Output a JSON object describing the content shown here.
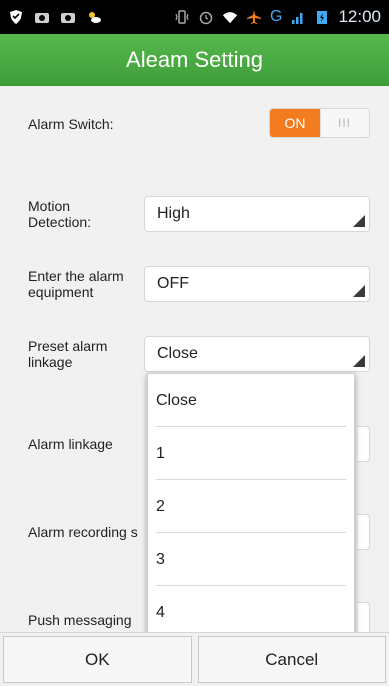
{
  "status_bar": {
    "time": "12:00",
    "network": "G",
    "left_icons": [
      "shield-icon",
      "camera-icon",
      "camera-icon",
      "weather-icon"
    ],
    "right_icons": [
      "vibrate-icon",
      "alarm-clock-icon",
      "wifi-icon",
      "airplane-icon",
      "signal-icon",
      "battery-icon"
    ]
  },
  "title": "Aleam Setting",
  "colors": {
    "title_bar": "#4caf45",
    "toggle_on": "#f47c20"
  },
  "settings": {
    "alarm_switch": {
      "label": "Alarm Switch:",
      "on_label": "ON",
      "thumb_label": "III",
      "state": "on"
    },
    "motion_detection": {
      "label": "Motion Detection:",
      "value": "High"
    },
    "enter_alarm_equipment": {
      "label": "Enter the alarm equipment",
      "value": "OFF"
    },
    "preset_alarm_linkage": {
      "label": "Preset alarm linkage",
      "value": "Close"
    },
    "alarm_linkage": {
      "label": "Alarm linkage"
    },
    "alarm_recording": {
      "label": "Alarm recording s"
    },
    "push_messaging": {
      "label": "Push messaging"
    }
  },
  "dropdown": {
    "options": [
      "Close",
      "1",
      "2",
      "3",
      "4"
    ]
  },
  "buttons": {
    "ok": "OK",
    "cancel": "Cancel"
  }
}
